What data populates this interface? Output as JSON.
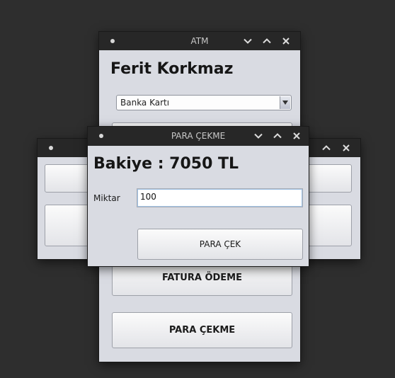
{
  "atm_window": {
    "title": "ATM",
    "user_name": "Ferit Korkmaz",
    "card_type": {
      "selected": "Banka Kartı"
    },
    "buttons": {
      "bill_payment": "FATURA ÖDEME",
      "withdraw": "PARA ÇEKME"
    }
  },
  "withdraw_window": {
    "title": "PARA ÇEKME",
    "balance_text": "Bakiye : 7050 TL",
    "amount_label": "Miktar",
    "amount_value": "100",
    "submit_label": "PARA ÇEK"
  },
  "colors": {
    "desktop": "#2e2e2e",
    "titlebar": "#272727",
    "window_bg": "#d9dbe2",
    "input_focus": "#9fc1e4"
  },
  "icons": {
    "menu": "menu-dot-icon",
    "minimize": "chevron-down-icon",
    "maximize": "chevron-up-icon",
    "close": "close-icon"
  }
}
